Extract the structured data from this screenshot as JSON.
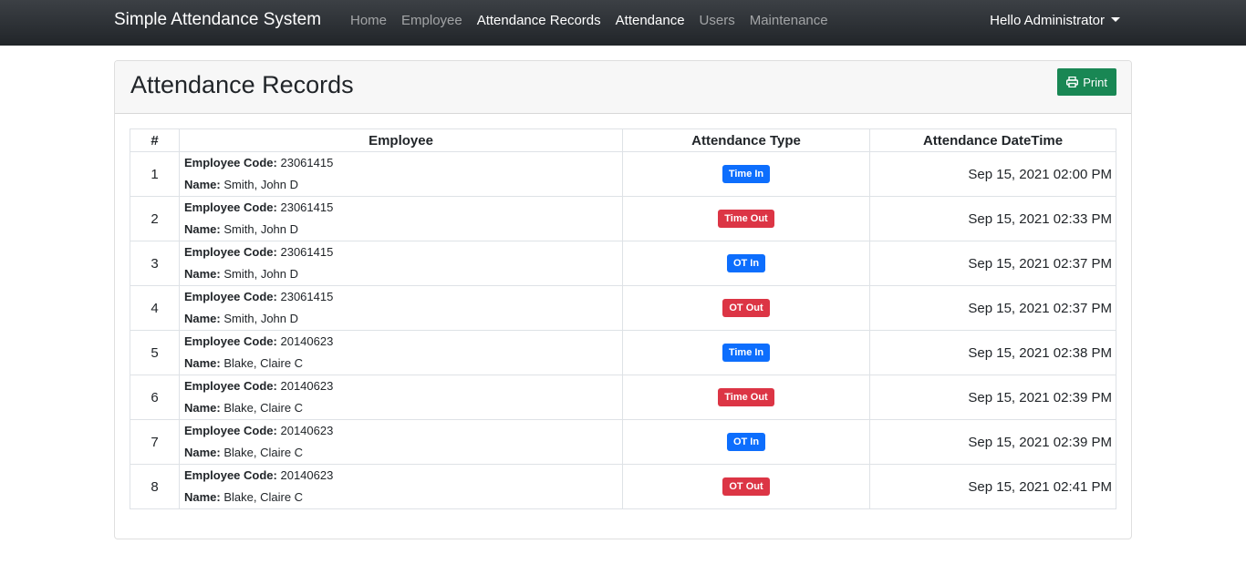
{
  "navbar": {
    "brand": "Simple Attendance System",
    "items": [
      {
        "label": "Home",
        "active": false
      },
      {
        "label": "Employee",
        "active": false
      },
      {
        "label": "Attendance Records",
        "active": true
      },
      {
        "label": "Attendance",
        "active": false
      },
      {
        "label": "Users",
        "active": false
      },
      {
        "label": "Maintenance",
        "active": false
      }
    ],
    "user_menu": "Hello Administrator"
  },
  "card": {
    "title": "Attendance Records",
    "print_label": "Print"
  },
  "colors": {
    "primary": "#0d6efd",
    "danger": "#dc3545",
    "success": "#198754"
  },
  "table": {
    "headers": [
      "#",
      "Employee",
      "Attendance Type",
      "Attendance DateTime"
    ],
    "code_label": "Employee Code:",
    "name_label": "Name:",
    "rows": [
      {
        "num": "1",
        "code": "23061415",
        "name": "Smith, John D",
        "type": "Time In",
        "kind": "in",
        "datetime": "Sep 15, 2021 02:00 PM"
      },
      {
        "num": "2",
        "code": "23061415",
        "name": "Smith, John D",
        "type": "Time Out",
        "kind": "out",
        "datetime": "Sep 15, 2021 02:33 PM"
      },
      {
        "num": "3",
        "code": "23061415",
        "name": "Smith, John D",
        "type": "OT In",
        "kind": "in",
        "datetime": "Sep 15, 2021 02:37 PM"
      },
      {
        "num": "4",
        "code": "23061415",
        "name": "Smith, John D",
        "type": "OT Out",
        "kind": "out",
        "datetime": "Sep 15, 2021 02:37 PM"
      },
      {
        "num": "5",
        "code": "20140623",
        "name": "Blake, Claire C",
        "type": "Time In",
        "kind": "in",
        "datetime": "Sep 15, 2021 02:38 PM"
      },
      {
        "num": "6",
        "code": "20140623",
        "name": "Blake, Claire C",
        "type": "Time Out",
        "kind": "out",
        "datetime": "Sep 15, 2021 02:39 PM"
      },
      {
        "num": "7",
        "code": "20140623",
        "name": "Blake, Claire C",
        "type": "OT In",
        "kind": "in",
        "datetime": "Sep 15, 2021 02:39 PM"
      },
      {
        "num": "8",
        "code": "20140623",
        "name": "Blake, Claire C",
        "type": "OT Out",
        "kind": "out",
        "datetime": "Sep 15, 2021 02:41 PM"
      }
    ]
  }
}
